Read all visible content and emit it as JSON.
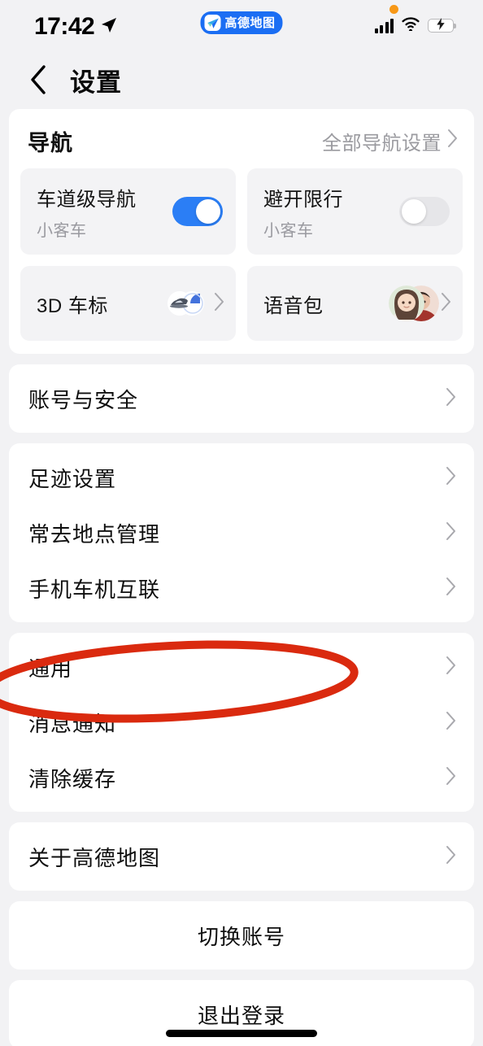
{
  "status_bar": {
    "time": "17:42",
    "location_icon": "location-arrow-icon",
    "app_badge": {
      "label": "高德地图",
      "icon": "amap-navigation-icon",
      "background_color": "#1b6ef3"
    },
    "recording_dot_color": "#f79817",
    "signal_icon": "cellular-signal-icon",
    "signal_bars": 4,
    "wifi_icon": "wifi-icon",
    "battery_icon": "battery-charging-icon",
    "battery_color": "#2fd157"
  },
  "nav_bar": {
    "back_icon": "chevron-left-icon",
    "title": "设置"
  },
  "navigation_section": {
    "title": "导航",
    "all_settings_link": "全部导航设置",
    "all_settings_chevron": "chevron-right-icon",
    "tiles": [
      {
        "label": "车道级导航",
        "sub": "小客车",
        "control": "toggle",
        "state": "on",
        "on_color": "#2b7ef5"
      },
      {
        "label": "避开限行",
        "sub": "小客车",
        "control": "toggle",
        "state": "off",
        "off_color": "#e6e6e9"
      },
      {
        "label": "3D 车标",
        "control": "thumbnail",
        "icon": "car-marker-icon",
        "chevron": "chevron-right-icon"
      },
      {
        "label": "语音包",
        "control": "avatars",
        "icon": "voice-pack-avatars",
        "chevron": "chevron-right-icon"
      }
    ]
  },
  "account_section": {
    "rows": [
      {
        "label": "账号与安全",
        "chevron": "chevron-right-icon"
      }
    ]
  },
  "tools_section": {
    "rows": [
      {
        "label": "足迹设置",
        "chevron": "chevron-right-icon"
      },
      {
        "label": "常去地点管理",
        "chevron": "chevron-right-icon"
      },
      {
        "label": "手机车机互联",
        "chevron": "chevron-right-icon"
      }
    ]
  },
  "system_section": {
    "rows": [
      {
        "label": "通用",
        "chevron": "chevron-right-icon",
        "highlighted": true
      },
      {
        "label": "消息通知",
        "chevron": "chevron-right-icon"
      },
      {
        "label": "清除缓存",
        "chevron": "chevron-right-icon"
      }
    ]
  },
  "about_section": {
    "rows": [
      {
        "label": "关于高德地图",
        "chevron": "chevron-right-icon"
      }
    ]
  },
  "switch_account_button": {
    "label": "切换账号"
  },
  "logout_button": {
    "label": "退出登录"
  },
  "annotation": {
    "type": "ellipse",
    "color": "#da2a0f",
    "stroke_width": 10,
    "targets": "通用"
  }
}
